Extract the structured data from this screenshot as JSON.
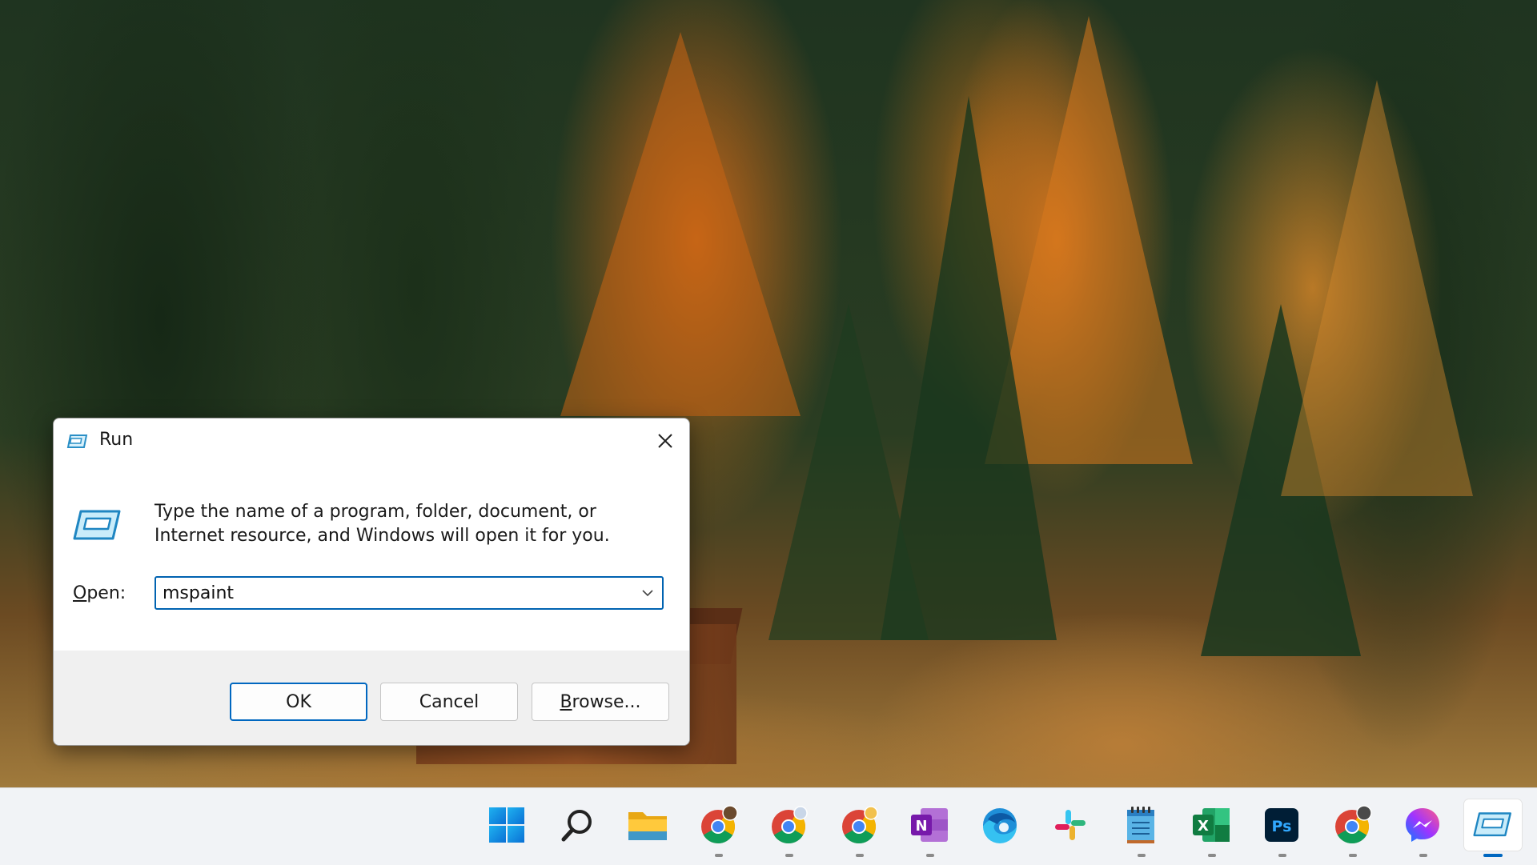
{
  "dialog": {
    "title": "Run",
    "description": "Type the name of a program, folder, document, or Internet resource, and Windows will open it for you.",
    "open_label_accel": "O",
    "open_label_rest": "pen:",
    "input_value": "mspaint",
    "ok_label": "OK",
    "cancel_label": "Cancel",
    "browse_accel": "B",
    "browse_rest": "rowse...",
    "icon": "run-icon",
    "accent": "#0067c0"
  },
  "taskbar": {
    "background": "#f1f3f6",
    "apps": [
      {
        "name": "start",
        "icon": "windows-logo-icon",
        "open": false
      },
      {
        "name": "search",
        "icon": "search-icon",
        "open": false
      },
      {
        "name": "file-explorer",
        "icon": "folder-icon",
        "open": false
      },
      {
        "name": "chrome-profile-1",
        "icon": "chrome-icon",
        "open": true
      },
      {
        "name": "chrome-profile-2",
        "icon": "chrome-icon",
        "open": true
      },
      {
        "name": "chrome-profile-3",
        "icon": "chrome-icon",
        "open": true
      },
      {
        "name": "onenote",
        "icon": "onenote-icon",
        "open": true
      },
      {
        "name": "edge",
        "icon": "edge-icon",
        "open": false
      },
      {
        "name": "slack",
        "icon": "slack-icon",
        "open": false
      },
      {
        "name": "notepad",
        "icon": "notepad-icon",
        "open": true
      },
      {
        "name": "excel",
        "icon": "excel-icon",
        "open": true
      },
      {
        "name": "photoshop",
        "icon": "photoshop-icon",
        "open": true
      },
      {
        "name": "chrome-profile-4",
        "icon": "chrome-icon",
        "open": true
      },
      {
        "name": "messenger",
        "icon": "messenger-icon",
        "open": true
      },
      {
        "name": "run",
        "icon": "run-icon",
        "open": true,
        "active": true
      }
    ],
    "letters": {
      "onenote": "N",
      "excel": "X",
      "photoshop": "Ps"
    }
  }
}
